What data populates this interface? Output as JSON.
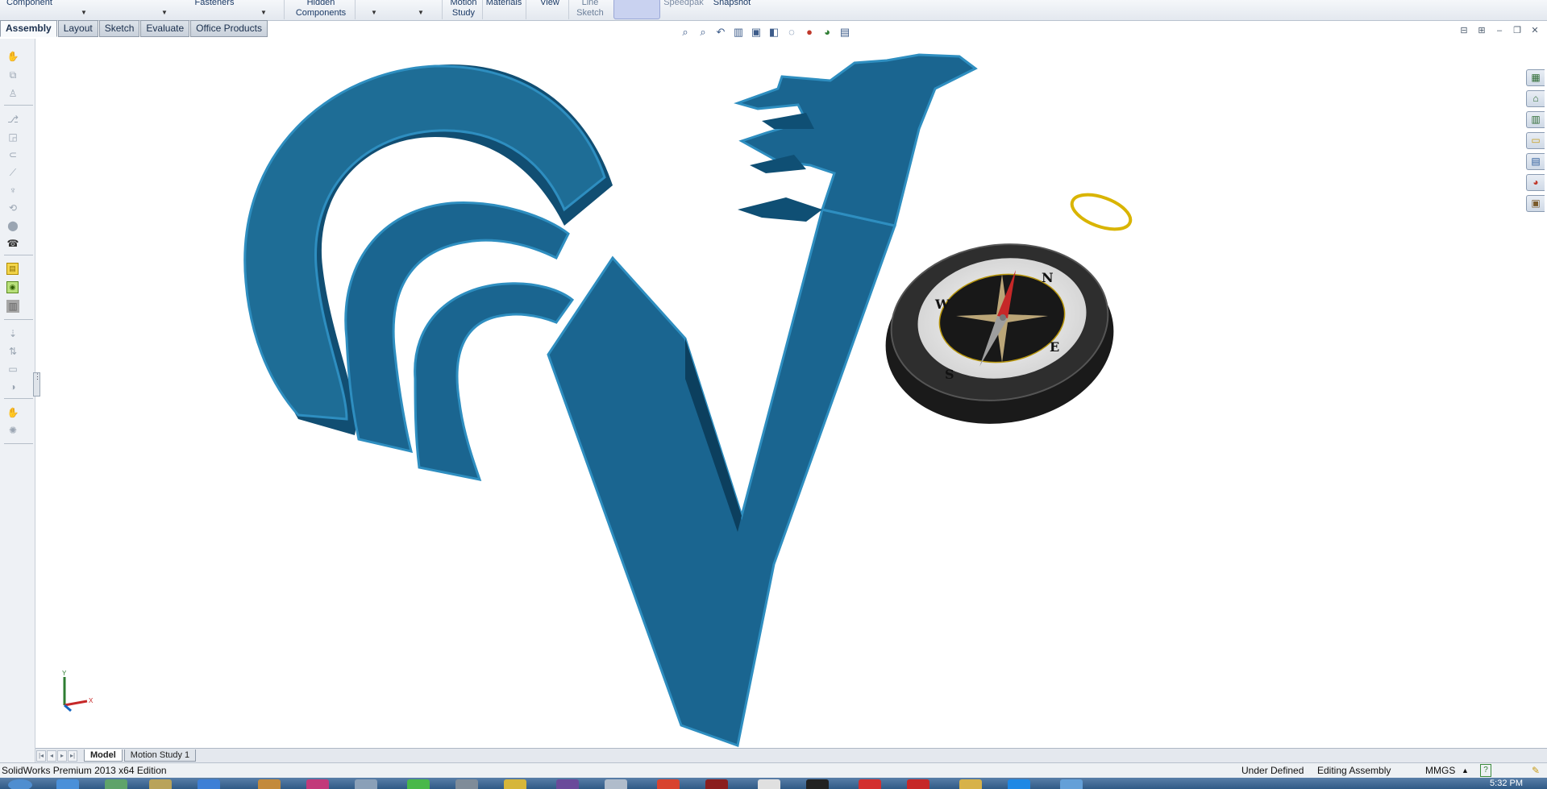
{
  "ribbon": {
    "items": [
      {
        "label": "Component"
      },
      {
        "label": "Fasteners"
      },
      {
        "label": "Hidden\nComponents"
      },
      {
        "label": "Motion\nStudy"
      },
      {
        "label": "Materials"
      },
      {
        "label": "View"
      },
      {
        "label": "Line\nSketch"
      },
      {
        "label": "Speedpak"
      },
      {
        "label": "Snapshot"
      }
    ]
  },
  "tabs": [
    {
      "label": "Assembly",
      "active": true
    },
    {
      "label": "Layout"
    },
    {
      "label": "Sketch"
    },
    {
      "label": "Evaluate"
    },
    {
      "label": "Office Products"
    }
  ],
  "model": {
    "logo_color": "#1e6d96",
    "compass_labels": {
      "north": "N",
      "east": "E",
      "south": "S",
      "west": "W"
    }
  },
  "triad": {
    "x_label": "X",
    "y_label": "Y"
  },
  "bottom_tabs": [
    {
      "label": "Model",
      "active": true
    },
    {
      "label": "Motion Study 1"
    }
  ],
  "status": {
    "product": "SolidWorks Premium 2013 x64 Edition",
    "definition": "Under Defined",
    "mode": "Editing Assembly",
    "units": "MMGS",
    "help": "?"
  },
  "taskbar": {
    "clock": "5:32 PM"
  }
}
